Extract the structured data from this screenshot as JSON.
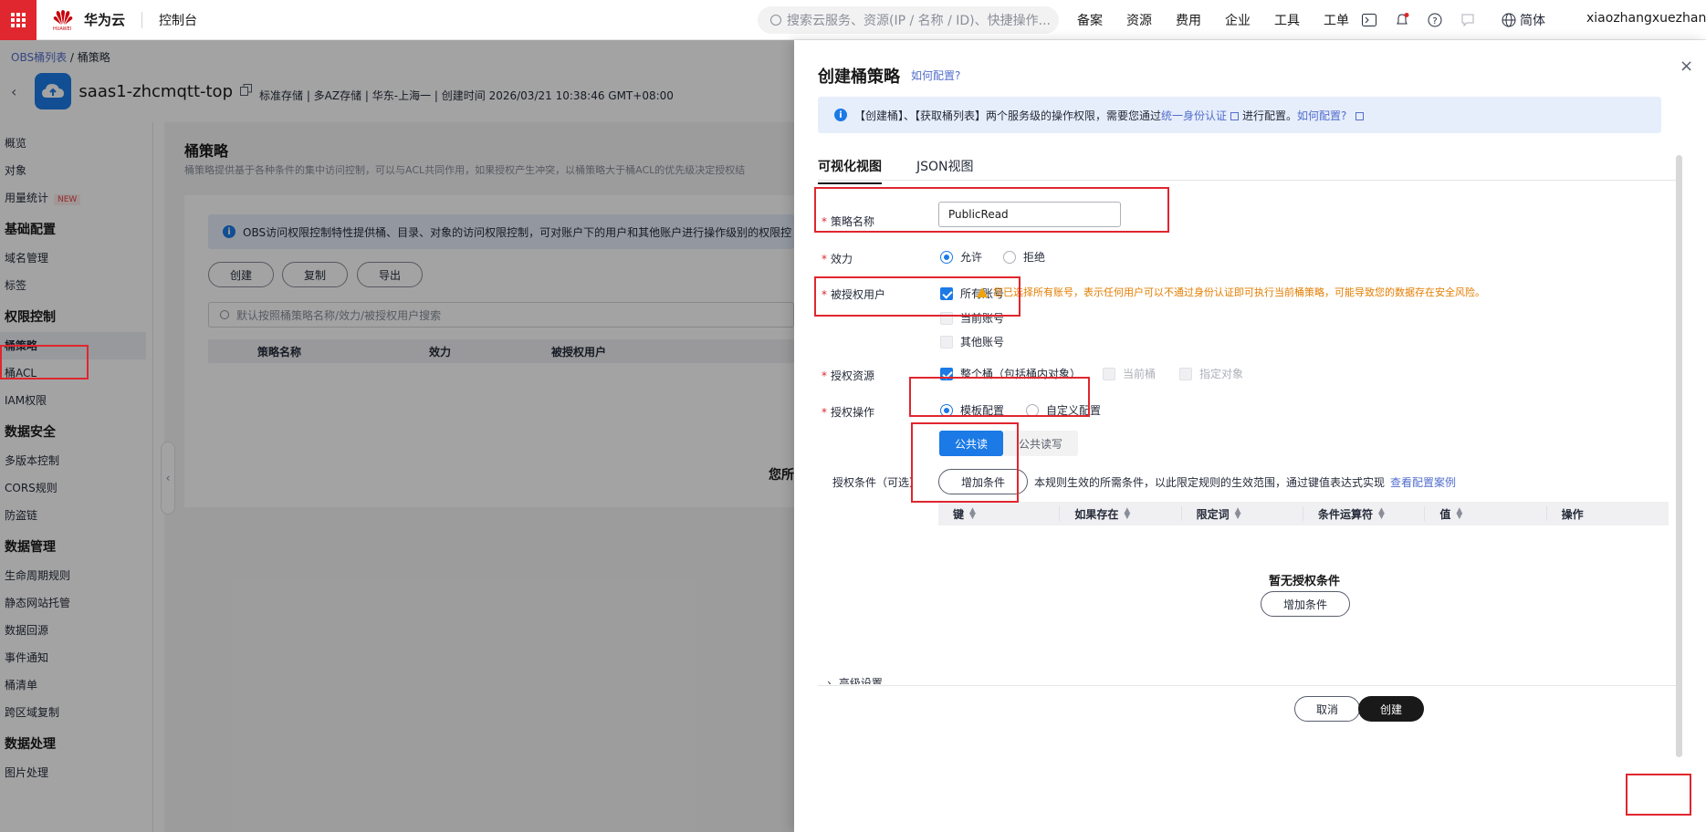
{
  "topbar": {
    "brand": "华为云",
    "brand_sub": "HUAWEI",
    "console": "控制台",
    "search_placeholder": "搜索云服务、资源(IP / 名称 / ID)、快捷操作...",
    "nav": [
      "备案",
      "资源",
      "费用",
      "企业",
      "工具",
      "工单"
    ],
    "lang": "简体",
    "username": "xiaozhangxuezhang1",
    "accent_color": "#e0262e"
  },
  "breadcrumb": {
    "parent": "OBS桶列表",
    "sep": " / ",
    "current": "桶策略"
  },
  "bucket": {
    "name": "saas1-zhcmqtt-top",
    "meta": "标准存储 | 多AZ存储 | 华东-上海一 | 创建时间  2026/03/21 10:38:46 GMT+08:00"
  },
  "sidebar": {
    "top_items": [
      "概览",
      "对象",
      "用量统计"
    ],
    "new_badge": "NEW",
    "groups": [
      {
        "title": "基础配置",
        "items": [
          "域名管理",
          "标签"
        ]
      },
      {
        "title": "权限控制",
        "items": [
          "桶策略",
          "桶ACL",
          "IAM权限"
        ]
      },
      {
        "title": "数据安全",
        "items": [
          "多版本控制",
          "CORS规则",
          "防盗链"
        ]
      },
      {
        "title": "数据管理",
        "items": [
          "生命周期规则",
          "静态网站托管",
          "数据回源",
          "事件通知",
          "桶清单",
          "跨区域复制"
        ]
      },
      {
        "title": "数据处理",
        "items": [
          "图片处理"
        ]
      }
    ]
  },
  "main": {
    "title": "桶策略",
    "desc": "桶策略提供基于各种条件的集中访问控制，可以与ACL共同作用，如果授权产生冲突，以桶策略大于桶ACL的优先级决定授权结",
    "info": "OBS访问权限控制特性提供桶、目录、对象的访问权限控制，可对账户下的用户和其他账户进行操作级别的权限控",
    "buttons": [
      "创建",
      "复制",
      "导出"
    ],
    "filter_placeholder": "默认按照桶策略名称/效力/被授权用户搜索",
    "table_headers": [
      "策略名称",
      "效力",
      "被授权用户"
    ],
    "empty_text": "您所"
  },
  "drawer": {
    "title": "创建桶策略",
    "howto": "如何配置?",
    "close": "×",
    "notice": {
      "part1": "【创建桶】、【获取桶列表】两个服务级的操作权限，需要您通过",
      "link1": "统一身份认证",
      "part2": "进行配置。",
      "link2": "如何配置?"
    },
    "tabs": [
      "可视化视图",
      "JSON视图"
    ],
    "fields": {
      "name_label": "策略名称",
      "name_value": "PublicRead",
      "effect_label": "效力",
      "effect_options": [
        "允许",
        "拒绝"
      ],
      "principal_label": "被授权用户",
      "principal_options": [
        "所有账号",
        "当前账号",
        "其他账号"
      ],
      "principal_warning": "您已选择所有账号，表示任何用户可以不通过身份认证即可执行当前桶策略，可能导致您的数据存在安全风险。",
      "resource_label": "授权资源",
      "resource_options": [
        "整个桶（包括桶内对象）",
        "当前桶",
        "指定对象"
      ],
      "action_label": "授权操作",
      "action_options": [
        "模板配置",
        "自定义配置"
      ],
      "templates": [
        "公共读",
        "公共读写"
      ],
      "condition_label": "授权条件（可选）",
      "add_condition": "增加条件",
      "condition_desc": "本规则生效的所需条件，以此限定规则的生效范围，通过键值表达式实现",
      "condition_link": "查看配置案例",
      "condition_headers": [
        "键",
        "如果存在",
        "限定词",
        "条件运算符",
        "值",
        "操作"
      ],
      "empty_title": "暂无授权条件",
      "empty_add": "增加条件",
      "advanced": "高级设置"
    },
    "footer": {
      "cancel": "取消",
      "create": "创建"
    }
  }
}
